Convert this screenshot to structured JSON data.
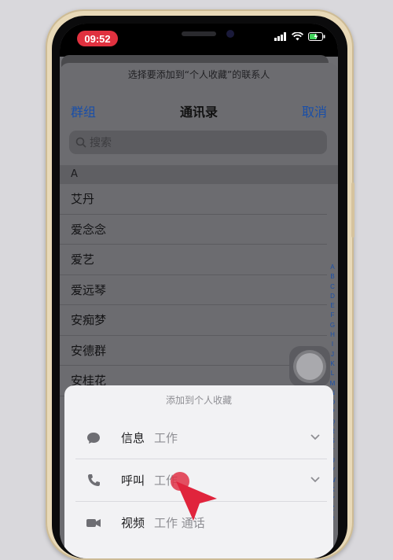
{
  "status": {
    "time": "09:52"
  },
  "sheet": {
    "prompt": "选择要添加到“个人收藏”的联系人"
  },
  "nav": {
    "left": "群组",
    "title": "通讯录",
    "right": "取消"
  },
  "search": {
    "placeholder": "搜索"
  },
  "section": "A",
  "contacts": [
    "艾丹",
    "爱念念",
    "爱艺",
    "爱远琴",
    "安痴梦",
    "安德群",
    "安桂花"
  ],
  "index_letters": [
    "A",
    "B",
    "C",
    "D",
    "E",
    "F",
    "G",
    "H",
    "I",
    "J",
    "K",
    "L",
    "M",
    "N",
    "O",
    "P",
    "Q",
    "R",
    "S",
    "T",
    "U",
    "V",
    "W",
    "X",
    "Y",
    "Z",
    "#"
  ],
  "action_sheet": {
    "title": "添加到个人收藏",
    "items": [
      {
        "label": "信息",
        "detail": "工作",
        "icon": "message-icon"
      },
      {
        "label": "呼叫",
        "detail": "工作",
        "icon": "phone-icon"
      },
      {
        "label": "视频",
        "detail": "工作    通话",
        "icon": "video-icon"
      }
    ]
  },
  "colors": {
    "accent": "#1a4fa8",
    "tap_marker": "#e03246",
    "time_pill": "#e0313f"
  }
}
